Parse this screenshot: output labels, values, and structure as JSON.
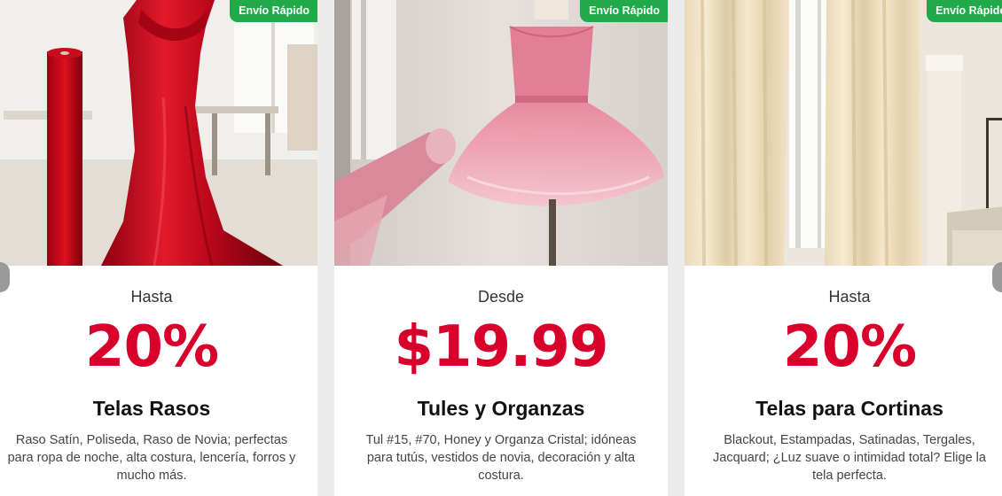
{
  "cards": [
    {
      "badge": "Envío Rápido",
      "prefix": "Hasta",
      "value": "20%",
      "title": "Telas Rasos",
      "description": "Raso Satín, Poliseda, Raso de Novia; perfectas para ropa de noche, alta costura, lencería, forros y mucho más."
    },
    {
      "badge": "Envío Rápido",
      "prefix": "Desde",
      "value": "$19.99",
      "title": "Tules y Organzas",
      "description": "Tul #15, #70, Honey y Organza Cristal; idóneas para tutús, vestidos de novia, decoración y alta costura."
    },
    {
      "badge": "Envío Rápido",
      "prefix": "Hasta",
      "value": "20%",
      "title": "Telas para Cortinas",
      "description": "Blackout, Estampadas, Satinadas, Tergales, Jacquard; ¿Luz suave o intimidad total? Elige la tela perfecta."
    }
  ],
  "colors": {
    "accent": "#d8002a",
    "badge": "#22a94a",
    "title": "#111111",
    "text": "#444444"
  },
  "icons": {
    "prev": "chevron-left-icon",
    "next": "chevron-right-icon"
  }
}
